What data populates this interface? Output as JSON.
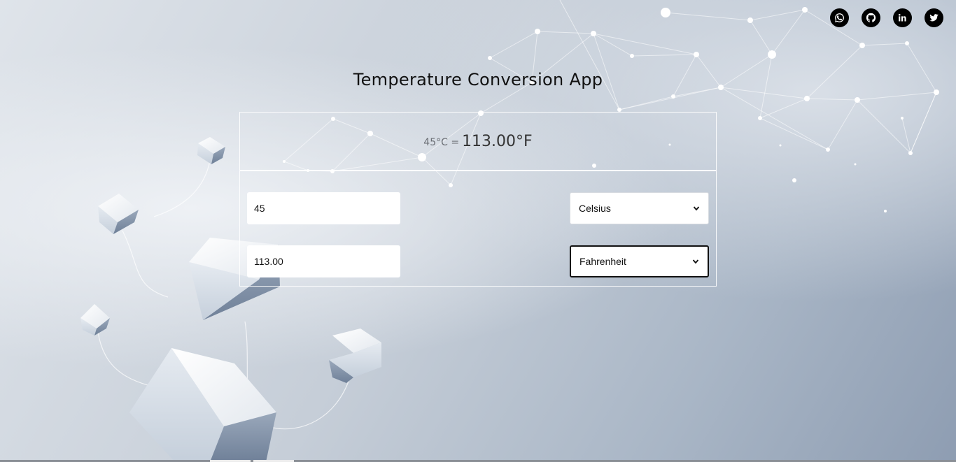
{
  "app": {
    "title": "Temperature Conversion App"
  },
  "social": [
    {
      "icon": "whatsapp-icon"
    },
    {
      "icon": "github-icon"
    },
    {
      "icon": "linkedin-icon"
    },
    {
      "icon": "twitter-icon"
    }
  ],
  "result": {
    "input_label": "45°C =",
    "output_label": "113.00°F"
  },
  "converter": {
    "from": {
      "value": "45",
      "unit": "Celsius"
    },
    "to": {
      "value": "113.00",
      "unit": "Fahrenheit"
    }
  },
  "colors": {
    "text": "#111111",
    "icon_bg": "#000000",
    "panel_border": "#ffffff"
  }
}
